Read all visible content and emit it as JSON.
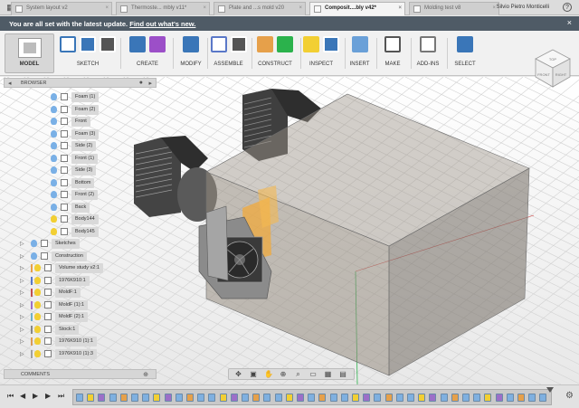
{
  "titlebar": {
    "tabs": [
      {
        "label": "System layout v2",
        "active": false
      },
      {
        "label": "Thermoste... mbly v11*",
        "active": false
      },
      {
        "label": "Plate and ...s mold v20",
        "active": false
      },
      {
        "label": "Composit....bly v42*",
        "active": true
      },
      {
        "label": "Molding test v8",
        "active": false
      }
    ],
    "user_name": "Silvio Pietro Monticelli",
    "help_glyph": "?"
  },
  "notice": {
    "text": "You are all set with the latest update.",
    "link": "Find out what's new."
  },
  "toolbar": {
    "workspace_label": "MODEL",
    "groups": [
      {
        "label": "SKETCH"
      },
      {
        "label": "CREATE"
      },
      {
        "label": "MODIFY"
      },
      {
        "label": "ASSEMBLE"
      },
      {
        "label": "CONSTRUCT"
      },
      {
        "label": "INSPECT"
      },
      {
        "label": "INSERT"
      },
      {
        "label": "MAKE"
      },
      {
        "label": "ADD-INS"
      },
      {
        "label": "SELECT"
      }
    ]
  },
  "browser": {
    "title": "BROWSER",
    "items": [
      {
        "label": "Foam (1)",
        "bulb": "blue",
        "has_arrow": false
      },
      {
        "label": "Foam (2)",
        "bulb": "blue",
        "has_arrow": false
      },
      {
        "label": "Front",
        "bulb": "blue",
        "has_arrow": false
      },
      {
        "label": "Foam (3)",
        "bulb": "blue",
        "has_arrow": false
      },
      {
        "label": "Side (2)",
        "bulb": "blue",
        "has_arrow": false
      },
      {
        "label": "Front (1)",
        "bulb": "blue",
        "has_arrow": false
      },
      {
        "label": "Side (3)",
        "bulb": "blue",
        "has_arrow": false
      },
      {
        "label": "Bottom",
        "bulb": "blue",
        "has_arrow": false
      },
      {
        "label": "Front (2)",
        "bulb": "blue",
        "has_arrow": false
      },
      {
        "label": "Back",
        "bulb": "blue",
        "has_arrow": false
      },
      {
        "label": "Body144",
        "bulb": "yellow",
        "has_arrow": false
      },
      {
        "label": "Body145",
        "bulb": "yellow",
        "has_arrow": false
      },
      {
        "label": "Sketches",
        "bulb": "blue",
        "has_arrow": true
      },
      {
        "label": "Construction",
        "bulb": "blue",
        "has_arrow": true
      },
      {
        "label": "Volume study v2:1",
        "bulb": "yellow",
        "has_arrow": true,
        "color": "#e6a04a"
      },
      {
        "label": "1976K910:1",
        "bulb": "yellow",
        "has_arrow": true,
        "color": "#5a78c8"
      },
      {
        "label": "MoldF:1",
        "bulb": "yellow",
        "has_arrow": true,
        "color": "#c05050"
      },
      {
        "label": "MoldF (1):1",
        "bulb": "yellow",
        "has_arrow": true,
        "color": "#9c6fc8"
      },
      {
        "label": "MoldF (2):1",
        "bulb": "yellow",
        "has_arrow": true,
        "color": "#6fb0c8"
      },
      {
        "label": "Stock:1",
        "bulb": "yellow",
        "has_arrow": true,
        "color": "#888888"
      },
      {
        "label": "1976K910 (1):1",
        "bulb": "yellow",
        "has_arrow": true,
        "color": "#d89a5a"
      },
      {
        "label": "1976K910 (1):3",
        "bulb": "yellow",
        "has_arrow": true,
        "color": "#a0a0a0"
      }
    ]
  },
  "comments": {
    "title": "COMMENTS"
  },
  "viewcube": {
    "top_face": "TOP",
    "front_face": "FRONT",
    "right_face": "RIGHT"
  },
  "colors": {
    "accent": "#3a76b8",
    "notice_bg": "#4f5b66",
    "bulb_blue": "#7ab0e6",
    "bulb_yellow": "#f2cf33"
  },
  "icons": {
    "nav": [
      "orbit-icon",
      "look-at-icon",
      "pan-icon",
      "zoom-icon",
      "fit-icon",
      "display-icon",
      "grid-icon",
      "viewports-icon"
    ],
    "timeline": [
      "first-icon",
      "prev-icon",
      "play-icon",
      "next-icon",
      "last-icon"
    ]
  }
}
